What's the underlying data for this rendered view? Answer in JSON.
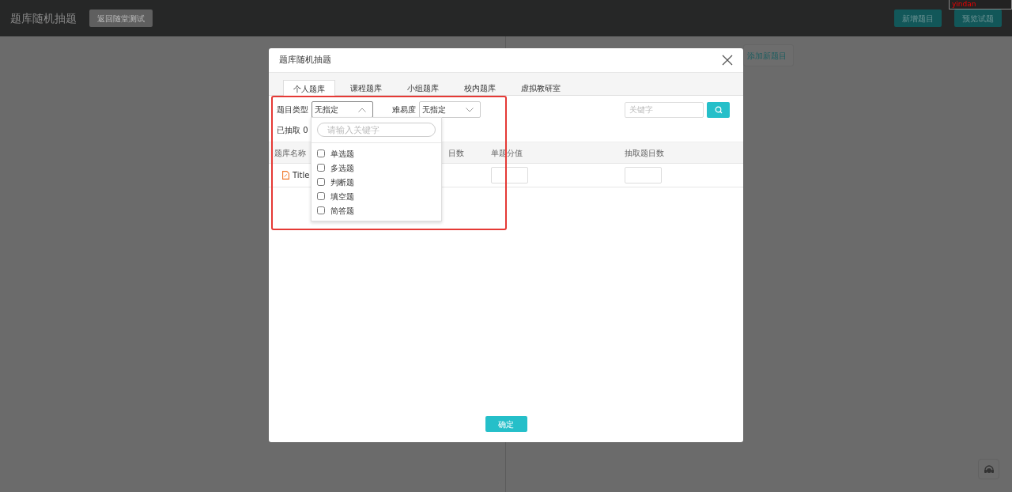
{
  "header": {
    "title": "题库随机抽题",
    "back_button": "返回随堂测试",
    "buttons": [
      "新增题目",
      "预览试题"
    ],
    "user_tag": "yindan"
  },
  "background": {
    "add_question_button": "添加新题目"
  },
  "modal": {
    "title": "题库随机抽题",
    "tabs": [
      {
        "label": "个人题库",
        "selected": true
      },
      {
        "label": "课程题库",
        "selected": false
      },
      {
        "label": "小组题库",
        "selected": false
      },
      {
        "label": "校内题库",
        "selected": false
      },
      {
        "label": "虚拟教研室",
        "selected": false
      }
    ],
    "filters": [
      {
        "label": "题目类型",
        "value": "无指定",
        "open": true
      },
      {
        "label": "难易度",
        "value": "无指定",
        "open": false
      }
    ],
    "search": {
      "placeholder": "关键字"
    },
    "summary": "已抽取 0",
    "table": {
      "columns": [
        "题库名称",
        "目数",
        "单题分值",
        "抽取题目数"
      ],
      "rows": [
        {
          "name": "Title"
        }
      ]
    },
    "dropdown": {
      "placeholder": "请输入关键字",
      "options": [
        {
          "label": "单选题",
          "checked": false
        },
        {
          "label": "多选题",
          "checked": false
        },
        {
          "label": "判断题",
          "checked": false
        },
        {
          "label": "填空题",
          "checked": false
        },
        {
          "label": "简答题",
          "checked": false
        }
      ]
    },
    "confirm_button": "确定"
  }
}
